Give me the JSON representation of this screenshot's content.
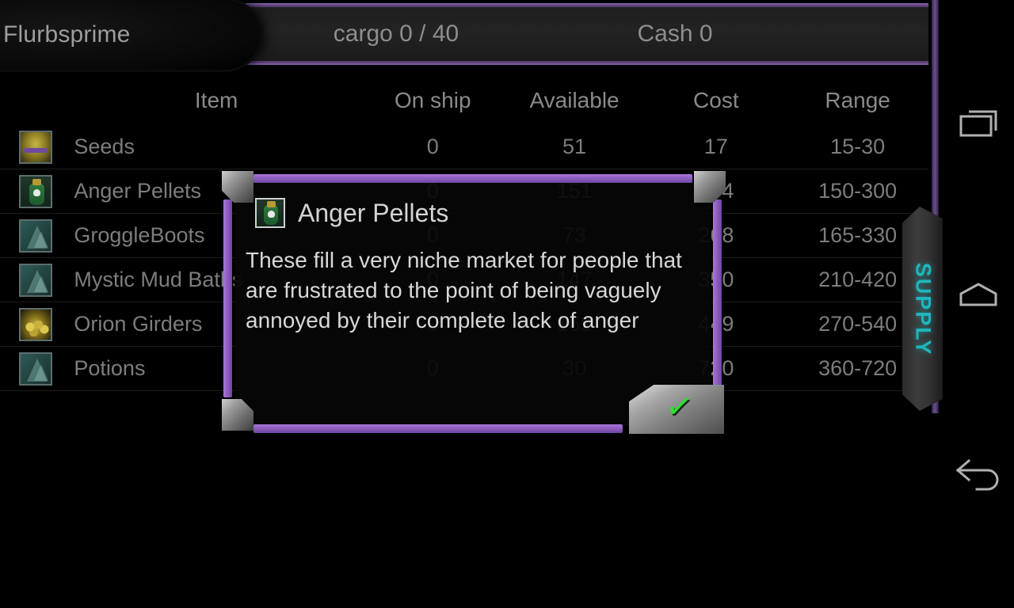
{
  "header": {
    "player_name": "Flurbsprime",
    "cargo_label": "cargo  0 / 40",
    "cash_label": "Cash  0"
  },
  "table": {
    "columns": [
      "Item",
      "On ship",
      "Available",
      "Cost",
      "Range"
    ],
    "rows": [
      {
        "icon": "seeds-icon",
        "item": "Seeds",
        "on_ship": "0",
        "available": "51",
        "cost": "17",
        "range": "15-30"
      },
      {
        "icon": "anger-pellets-icon",
        "item": "Anger Pellets",
        "on_ship": "0",
        "available": "151",
        "cost": "294",
        "range": "150-300"
      },
      {
        "icon": "groggleboots-icon",
        "item": "GroggleBoots",
        "on_ship": "0",
        "available": "73",
        "cost": "268",
        "range": "165-330"
      },
      {
        "icon": "mystic-mud-icon",
        "item": "Mystic Mud Baths",
        "on_ship": "0",
        "available": "147",
        "cost": "350",
        "range": "210-420"
      },
      {
        "icon": "orion-girders-icon",
        "item": "Orion Girders",
        "on_ship": "0",
        "available": "169",
        "cost": "449",
        "range": "270-540"
      },
      {
        "icon": "potions-icon",
        "item": "Potions",
        "on_ship": "0",
        "available": "30",
        "cost": "720",
        "range": "360-720"
      }
    ]
  },
  "supply_tab": {
    "label": "SUPPLY",
    "color": "#1fb6bd"
  },
  "dialog": {
    "title": "Anger Pellets",
    "icon": "anger-pellets-icon",
    "body": "These fill a very niche market for people that are frustrated to the point of being vaguely annoyed by their complete lack of anger",
    "confirm_glyph": "✓",
    "frame_color": "#8d5fc0"
  },
  "navbar": {
    "recents_label": "recents",
    "home_label": "home",
    "back_label": "back"
  }
}
